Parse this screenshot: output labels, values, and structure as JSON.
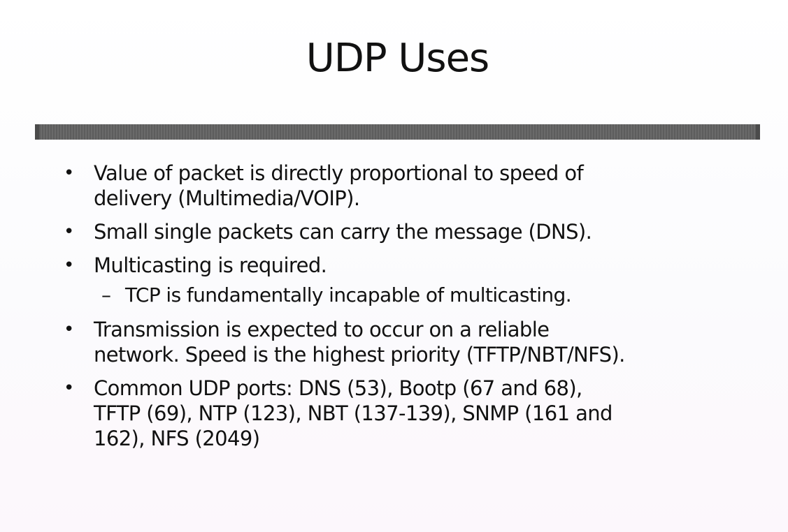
{
  "slide": {
    "title": "UDP Uses",
    "bullets": [
      {
        "lines": [
          "Value of packet is directly proportional to speed of",
          "delivery (Multimedia/VOIP)."
        ]
      },
      {
        "lines": [
          "Small single packets can carry the message (DNS)."
        ]
      },
      {
        "lines": [
          "Multicasting is required."
        ],
        "sub": [
          "TCP is fundamentally incapable of multicasting."
        ]
      },
      {
        "lines": [
          "Transmission is expected to occur on a reliable",
          "network. Speed is the highest priority (TFTP/NBT/NFS)."
        ]
      },
      {
        "lines": [
          "Common UDP ports: DNS (53), Bootp (67 and 68),",
          "TFTP (69), NTP (123), NBT (137-139), SNMP (161 and",
          "162), NFS (2049)"
        ]
      }
    ],
    "bullet_glyph": "•",
    "sub_glyph": "–"
  },
  "colors": {
    "rule": "#5d5d5d",
    "text": "#111111",
    "background": "#ffffff"
  }
}
